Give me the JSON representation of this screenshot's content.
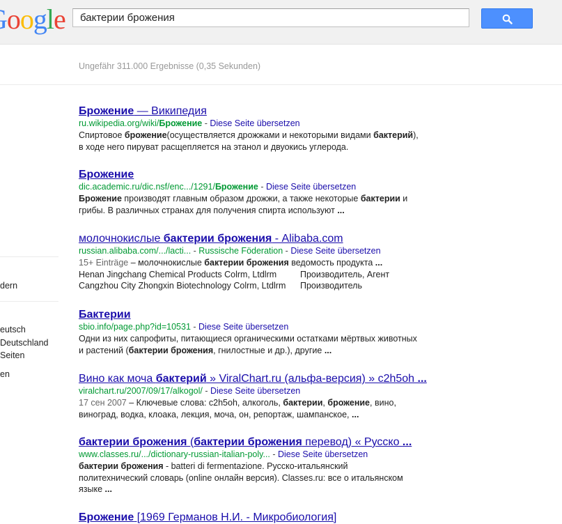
{
  "query": "бактерии брожения",
  "stats": "Ungefähr 311.000 Ergebnisse (0,35 Sekunden)",
  "sidebar": [
    "dern",
    "eutsch",
    "Deutschland",
    "Seiten",
    "en"
  ],
  "translate_label": "Diese Seite übersetzen",
  "results": [
    {
      "title": [
        {
          "t": "Брожение",
          "b": true
        },
        {
          "t": " — Википедия",
          "b": false
        }
      ],
      "url": [
        {
          "t": "ru.wikipedia.org/wiki/",
          "b": false
        },
        {
          "t": "Брожение",
          "b": true
        }
      ],
      "snippet": [
        [
          {
            "t": "Спиртовое ",
            "b": false
          },
          {
            "t": "брожение",
            "b": true
          },
          {
            "t": "(осуществляется дрожжами и некоторыми видами ",
            "b": false
          },
          {
            "t": "бактерий",
            "b": true
          },
          {
            "t": "),",
            "b": false
          }
        ],
        [
          {
            "t": "в ходе него пируват расщепляется на этанол и двуокись углерода.",
            "b": false
          }
        ]
      ]
    },
    {
      "title": [
        {
          "t": "Брожение",
          "b": true
        }
      ],
      "url": [
        {
          "t": "dic.academic.ru/dic.nsf/enc.../1291/",
          "b": false
        },
        {
          "t": "Брожение",
          "b": true
        }
      ],
      "snippet": [
        [
          {
            "t": "Брожение",
            "b": true
          },
          {
            "t": " производят главным образом дрожжи, а также некоторые ",
            "b": false
          },
          {
            "t": "бактерии",
            "b": true
          },
          {
            "t": " и",
            "b": false
          }
        ],
        [
          {
            "t": "грибы. В различных странах для получения спирта используют ",
            "b": false
          },
          {
            "t": "...",
            "b": true
          }
        ]
      ]
    },
    {
      "title": [
        {
          "t": "молочнокислые ",
          "b": false
        },
        {
          "t": "бактерии брожения",
          "b": true
        },
        {
          "t": " - Alibaba.com",
          "b": false
        }
      ],
      "url": [
        {
          "t": "russian.alibaba.com/.../lacti...",
          "b": false
        }
      ],
      "region": "Russische Föderation",
      "snippet": [
        [
          {
            "t": "15+ Einträge",
            "d": true
          },
          {
            "t": " – молочнокислые ",
            "b": false
          },
          {
            "t": "бактерии брожения",
            "b": true
          },
          {
            "t": " ведомость продукта ",
            "b": false
          },
          {
            "t": "...",
            "b": true
          }
        ]
      ],
      "table": [
        [
          "Henan Jingchang Chemical Products Colrm, Ltdlrm",
          "Производитель, Агент"
        ],
        [
          "Cangzhou City Zhongxin Biotechnology Colrm, Ltdlrm",
          "Производитель"
        ]
      ]
    },
    {
      "title": [
        {
          "t": "Бактерии",
          "b": true
        }
      ],
      "url": [
        {
          "t": "sbio.info/page.php?id=10531",
          "b": false
        }
      ],
      "snippet": [
        [
          {
            "t": "Одни из них сапрофиты, питающиеся органическими остатками мёртвых животных",
            "b": false
          }
        ],
        [
          {
            "t": "и растений (",
            "b": false
          },
          {
            "t": "бактерии брожения",
            "b": true
          },
          {
            "t": ", гнилостные и др.), другие ",
            "b": false
          },
          {
            "t": "...",
            "b": true
          }
        ]
      ]
    },
    {
      "title": [
        {
          "t": "Вино как моча ",
          "b": false
        },
        {
          "t": "бактерий",
          "b": true
        },
        {
          "t": " » ViralChart.ru (альфа-версия) » c2h5oh ",
          "b": false
        },
        {
          "t": "...",
          "b": true
        }
      ],
      "url": [
        {
          "t": "viralchart.ru/2007/09/17/alkogol/",
          "b": false
        }
      ],
      "snippet": [
        [
          {
            "t": "17 сен 2007",
            "d": true
          },
          {
            "t": " – Ключевые слова: c2h5oh, алкоголь, ",
            "b": false
          },
          {
            "t": "бактерии",
            "b": true
          },
          {
            "t": ", ",
            "b": false
          },
          {
            "t": "брожение",
            "b": true
          },
          {
            "t": ", вино,",
            "b": false
          }
        ],
        [
          {
            "t": "виноград, водка, клоака, лекция, моча, он, репортаж, шампанское, ",
            "b": false
          },
          {
            "t": "...",
            "b": true
          }
        ]
      ]
    },
    {
      "title": [
        {
          "t": "бактерии брожения",
          "b": true
        },
        {
          "t": " (",
          "b": false
        },
        {
          "t": "бактерии брожения",
          "b": true
        },
        {
          "t": " перевод) « Русско ",
          "b": false
        },
        {
          "t": "...",
          "b": true
        }
      ],
      "url": [
        {
          "t": "www.classes.ru/.../dictionary-russian-italian-poly...",
          "b": false
        }
      ],
      "snippet": [
        [
          {
            "t": "бактерии брожения",
            "b": true
          },
          {
            "t": " - batteri di fermentazione. Русско-итальянский",
            "b": false
          }
        ],
        [
          {
            "t": "политехнический словарь (online онлайн версия). Classes.ru: все о итальянском",
            "b": false
          }
        ],
        [
          {
            "t": "языке ",
            "b": false
          },
          {
            "t": "...",
            "b": true
          }
        ]
      ]
    },
    {
      "title": [
        {
          "t": "Брожение",
          "b": true
        },
        {
          "t": " [1969 Германов Н.И. - Микробиология]",
          "b": false
        }
      ],
      "url": [],
      "snippet": []
    }
  ]
}
